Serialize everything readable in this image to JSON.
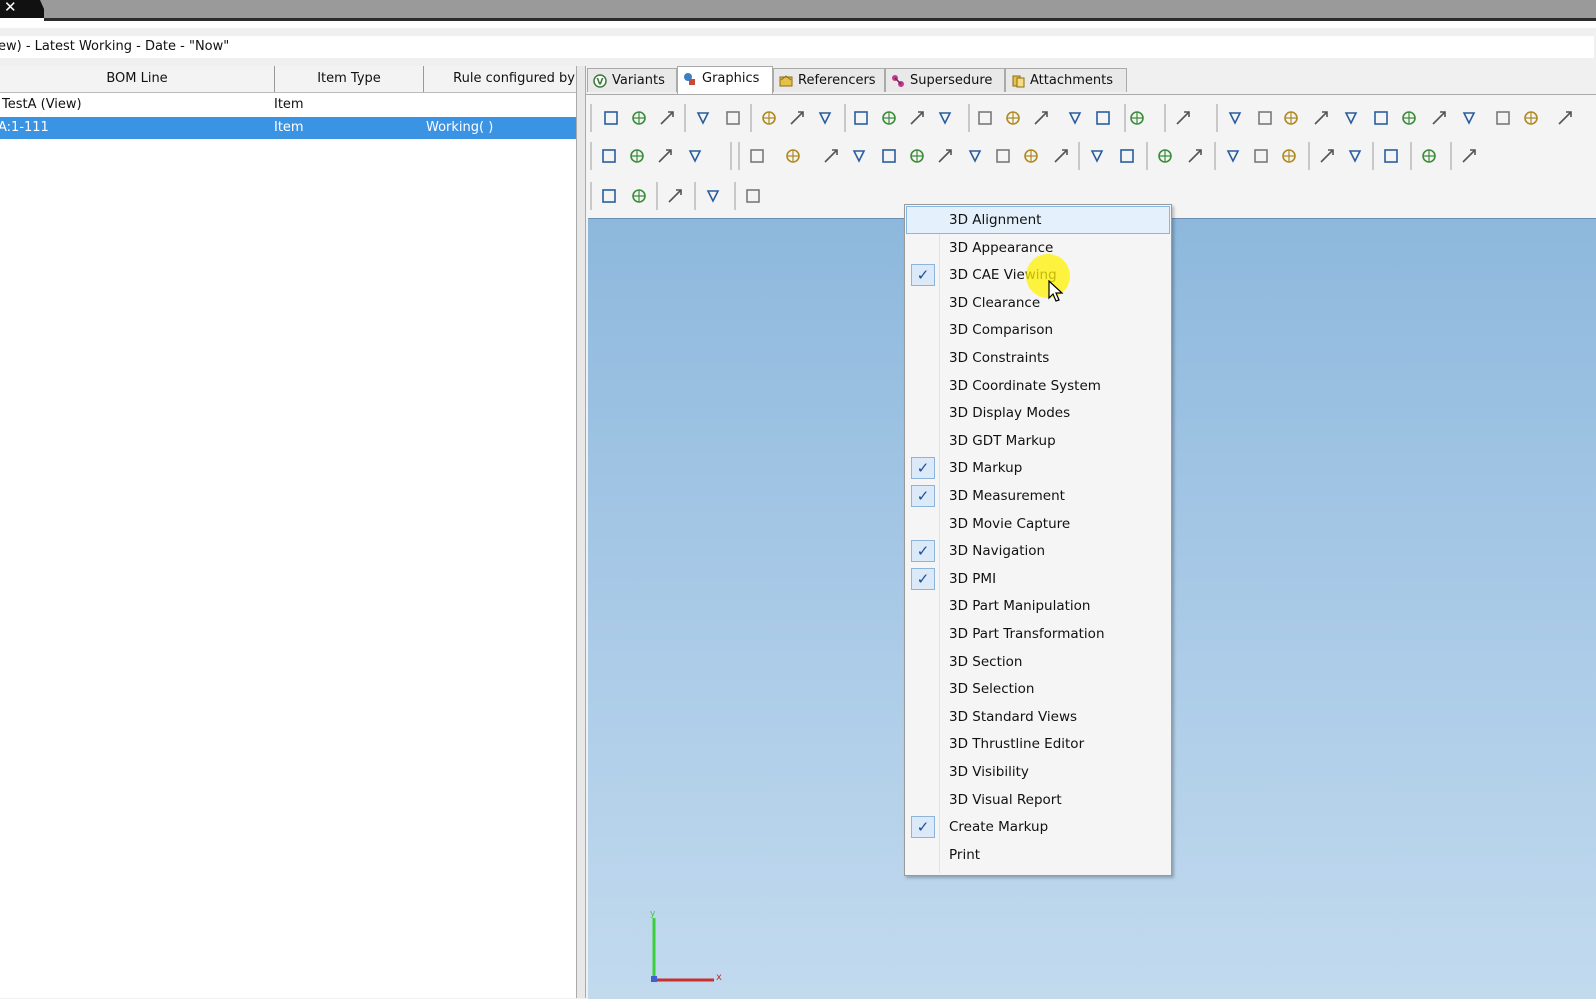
{
  "window": {
    "close_glyph": "✕",
    "context_line": "ew) - Latest Working - Date - \"Now\""
  },
  "bom_table": {
    "columns": [
      "BOM Line",
      "Item Type",
      "Rule configured by"
    ],
    "rows": [
      {
        "bom_line": "TestA (View)",
        "item_type": "Item",
        "rule": ""
      },
      {
        "bom_line": "A:1-111",
        "item_type": "Item",
        "rule": "Working( )"
      }
    ],
    "selected_row": 1,
    "selection_color": "#3b93e4"
  },
  "tabs": [
    {
      "label": "Variants",
      "icon": "variants-icon",
      "active": false
    },
    {
      "label": "Graphics",
      "icon": "graphics-icon",
      "active": true
    },
    {
      "label": "Referencers",
      "icon": "referencers-icon",
      "active": false
    },
    {
      "label": "Supersedure",
      "icon": "supersedure-icon",
      "active": false
    },
    {
      "label": "Attachments",
      "icon": "attachments-icon",
      "active": false
    }
  ],
  "context_menu": {
    "items": [
      {
        "label": "3D Alignment",
        "checked": false,
        "highlighted": true
      },
      {
        "label": "3D Appearance",
        "checked": false
      },
      {
        "label": "3D CAE Viewing",
        "checked": true
      },
      {
        "label": "3D Clearance",
        "checked": false
      },
      {
        "label": "3D Comparison",
        "checked": false
      },
      {
        "label": "3D Constraints",
        "checked": false
      },
      {
        "label": "3D Coordinate System",
        "checked": false
      },
      {
        "label": "3D Display Modes",
        "checked": false
      },
      {
        "label": "3D GDT Markup",
        "checked": false
      },
      {
        "label": "3D Markup",
        "checked": true
      },
      {
        "label": "3D Measurement",
        "checked": true
      },
      {
        "label": "3D Movie Capture",
        "checked": false
      },
      {
        "label": "3D Navigation",
        "checked": true
      },
      {
        "label": "3D PMI",
        "checked": true
      },
      {
        "label": "3D Part Manipulation",
        "checked": false
      },
      {
        "label": "3D Part Transformation",
        "checked": false
      },
      {
        "label": "3D Section",
        "checked": false
      },
      {
        "label": "3D Selection",
        "checked": false
      },
      {
        "label": "3D Standard Views",
        "checked": false
      },
      {
        "label": "3D Thrustline Editor",
        "checked": false
      },
      {
        "label": "3D Visibility",
        "checked": false
      },
      {
        "label": "3D Visual Report",
        "checked": false
      },
      {
        "label": "Create Markup",
        "checked": true
      },
      {
        "label": "Print",
        "checked": false
      }
    ],
    "check_glyph": "✓"
  },
  "colors": {
    "viewport_top": "#8db8dc",
    "viewport_bottom": "#c2daee",
    "cursor_highlight": "#fff000"
  }
}
